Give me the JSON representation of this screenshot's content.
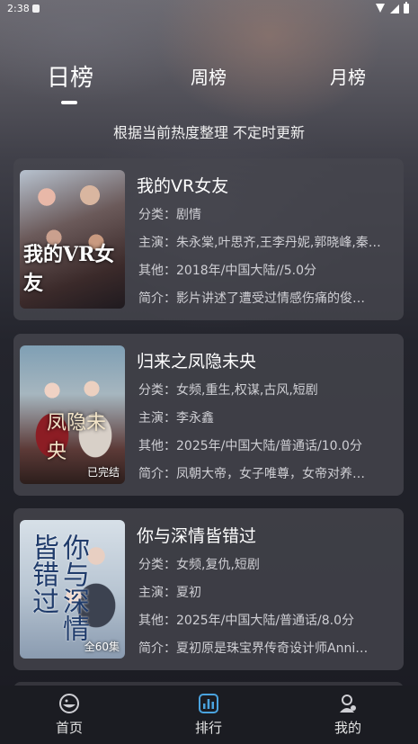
{
  "status_bar": {
    "time": "2:38"
  },
  "tabs": [
    {
      "label": "日榜",
      "active": true
    },
    {
      "label": "周榜",
      "active": false
    },
    {
      "label": "月榜",
      "active": false
    }
  ],
  "subtitle": "根据当前热度整理 不定时更新",
  "items": [
    {
      "title": "我的VR女友",
      "category": "分类：剧情",
      "cast": "主演：朱永棠,叶思齐,王李丹妮,郭晓峰,秦…",
      "other": "其他：2018年/中国大陆//5.0分",
      "intro": "简介：影片讲述了遭受过情感伤痛的俊…",
      "badge": "",
      "poster_text": "我的VR女友"
    },
    {
      "title": "归来之凤隐未央",
      "category": "分类：女频,重生,权谋,古风,短剧",
      "cast": "主演：李永鑫",
      "other": "其他：2025年/中国大陆/普通话/10.0分",
      "intro": "简介：凤朝大帝，女子唯尊，女帝对养…",
      "badge": "已完结",
      "poster_text": "凤隐未央"
    },
    {
      "title": "你与深情皆错过",
      "category": "分类：女频,复仇,短剧",
      "cast": "主演：夏初",
      "other": "其他：2025年/中国大陆/普通话/8.0分",
      "intro": "简介：夏初原是珠宝界传奇设计师Anni…",
      "badge": "全60集",
      "poster_text": "你与深情皆错过"
    }
  ],
  "bottom_nav": [
    {
      "label": "首页",
      "icon": "home-icon",
      "active": false
    },
    {
      "label": "排行",
      "icon": "ranking-icon",
      "active": true
    },
    {
      "label": "我的",
      "icon": "profile-icon",
      "active": false
    }
  ],
  "colors": {
    "accent": "#4aa3df",
    "card": "#46464e"
  }
}
